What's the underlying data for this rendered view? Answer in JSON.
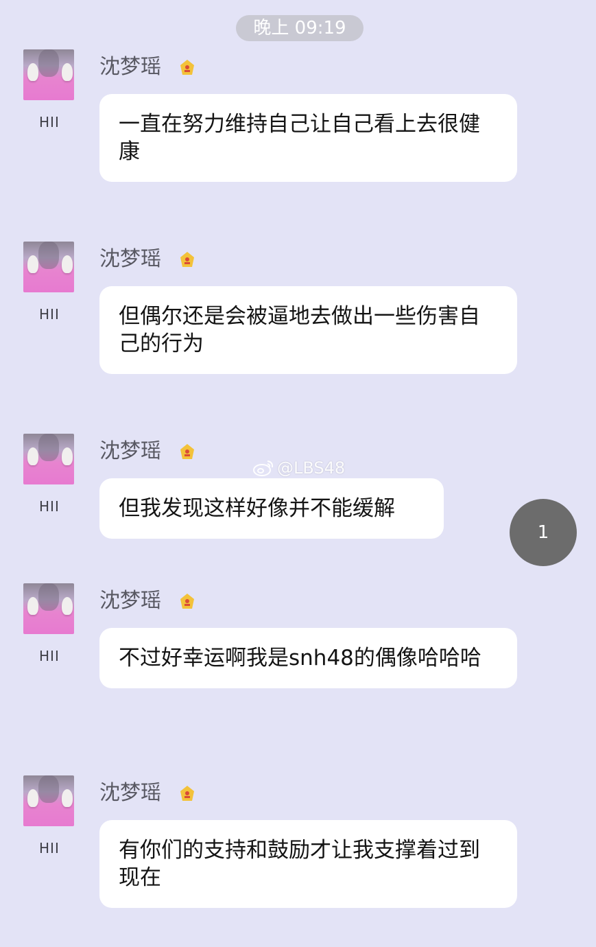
{
  "timestamp": "晚上 09:19",
  "messages": [
    {
      "sender": "沈梦瑶",
      "rank": "HII",
      "text": "一直在努力维持自己让自己看上去很健康"
    },
    {
      "sender": "沈梦瑶",
      "rank": "HII",
      "text": "但偶尔还是会被逼地去做出一些伤害自己的行为"
    },
    {
      "sender": "沈梦瑶",
      "rank": "HII",
      "text": "但我发现这样好像并不能缓解"
    },
    {
      "sender": "沈梦瑶",
      "rank": "HII",
      "text": "不过好幸运啊我是snh48的偶像哈哈哈"
    },
    {
      "sender": "沈梦瑶",
      "rank": "HII",
      "text": "有你们的支持和鼓励才让我支撑着过到现在"
    }
  ],
  "watermark": "@LBS48",
  "unread_count": "1",
  "colors": {
    "background": "#e3e3f6",
    "bubble": "#ffffff",
    "badge": "#f3c23a"
  },
  "icons": {
    "badge": "crown-badge-icon",
    "watermark": "weibo-icon"
  }
}
